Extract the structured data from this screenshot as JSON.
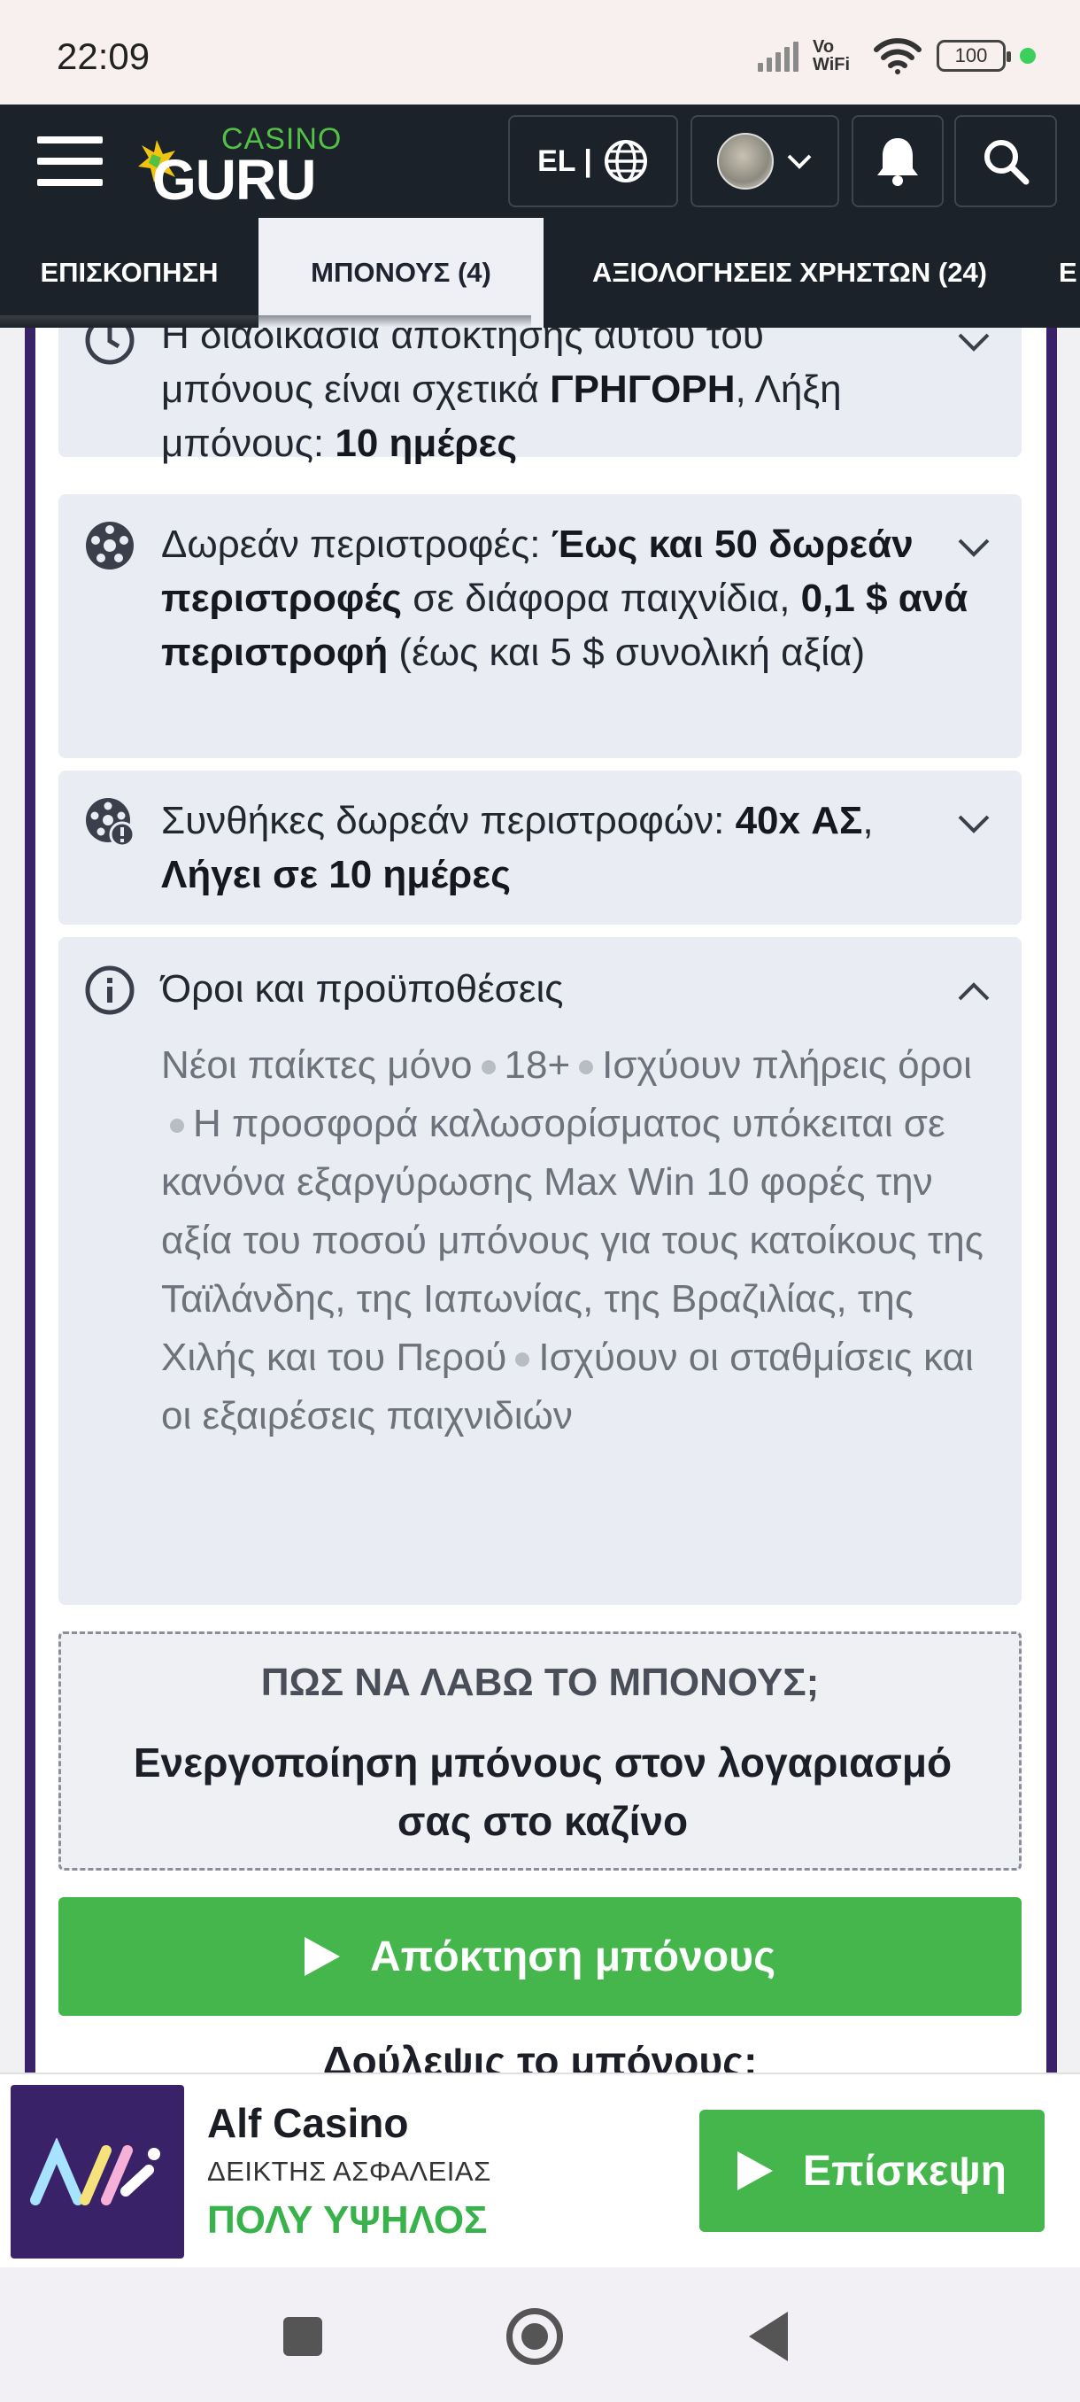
{
  "status_bar": {
    "time": "22:09",
    "network": "Vo WiFi",
    "battery": "100"
  },
  "header": {
    "logo_top": "CASINO",
    "logo_main": "GURU",
    "language": "EL |"
  },
  "tabs": [
    {
      "label": "ΕΠΙΣΚΟΠΗΣΗ",
      "active": false
    },
    {
      "label": "ΜΠΟΝΟΥΣ  (4)",
      "active": true
    },
    {
      "label": "ΑΞΙΟΛΟΓΗΣΕΙΣ ΧΡΗΣΤΩΝ (24)",
      "active": false
    },
    {
      "label": "Ε",
      "active": false
    }
  ],
  "cards": {
    "speed": {
      "line1": "Η διαδικασία απόκτησης αυτού του",
      "line2_pre": "μπόνους είναι σχετικά ",
      "line2_bold": "ΓΡΗΓΟΡΗ",
      "line2_post": ", Λήξη",
      "line3_pre": "μπόνους: ",
      "line3_bold": "10 ημέρες"
    },
    "free_spins": {
      "pre": "Δωρεάν περιστροφές: ",
      "bold1": "Έως και 50 δωρεάν περιστροφές",
      "mid": " σε διάφορα παιχνίδια, ",
      "bold2": "0,1 $ ανά περιστροφή",
      "post": " (έως και 5 $ συνολική αξία)"
    },
    "spin_conditions": {
      "pre": "Συνθήκες δωρεάν περιστροφών: ",
      "bold1": "40x ΑΣ",
      "mid": ", ",
      "bold2": "Λήγει σε 10 ημέρες"
    },
    "terms": {
      "title": "Όροι και προϋποθέσεις",
      "item1": "Νέοι παίκτες μόνο",
      "item2": "18+",
      "item3": "Ισχύουν πλήρεις όροι",
      "item4": "Η προσφορά καλωσορίσματος υπόκειται σε κανόνα εξαργύρωσης Max Win 10 φορές την αξία του ποσού μπόνους για τους κατοίκους της Ταϊλάνδης, της Ιαπωνίας, της Βραζιλίας, της Χιλής και του Περού",
      "item5": "Ισχύουν οι σταθμίσεις και οι εξαιρέσεις παιχνιδιών"
    }
  },
  "howto": {
    "title": "ΠΩΣ ΝΑ ΛΑΒΩ ΤΟ ΜΠΟΝΟΥΣ;",
    "text": "Ενεργοποίηση μπόνους στον λογαριασμό σας στο καζίνο"
  },
  "claim_button": "Απόκτηση μπόνους",
  "cut_heading": "Δούλεψις το μπόνους:",
  "ad": {
    "name": "Alf Casino",
    "safety_label": "ΔΕΙΚΤΗΣ ΑΣΦΑΛΕΙΑΣ",
    "safety_value": "ΠΟΛΥ ΥΨΗΛΟΣ",
    "visit_button": "Επίσκεψη"
  },
  "colors": {
    "header_bg": "#1c2229",
    "accent_green": "#45b64c",
    "frame_purple": "#3a2268",
    "card_bg": "#e9ecf2"
  }
}
